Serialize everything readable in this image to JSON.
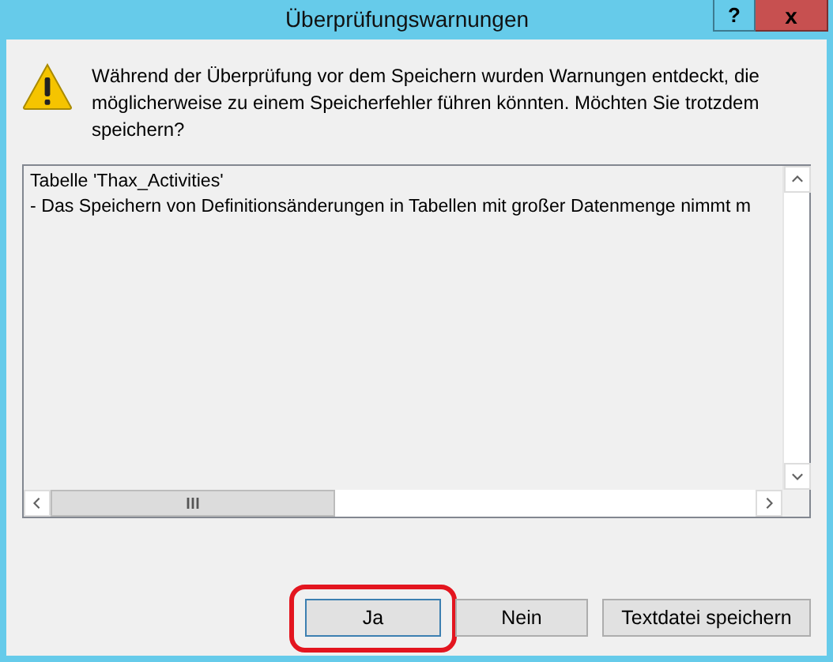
{
  "window": {
    "title": "Überprüfungswarnungen",
    "help_button": "?",
    "close_button": "x"
  },
  "message": "Während der Überprüfung vor dem Speichern wurden Warnungen entdeckt, die möglicherweise zu einem Speicherfehler führen könnten. Möchten Sie trotzdem speichern?",
  "details": {
    "lines": [
      "Tabelle 'Thax_Activities'",
      "- Das Speichern von Definitionsänderungen in Tabellen mit großer Datenmenge nimmt m"
    ]
  },
  "buttons": [
    {
      "label": "Ja",
      "focused": true,
      "highlighted": true
    },
    {
      "label": "Nein",
      "focused": false,
      "highlighted": false
    },
    {
      "label": "Textdatei speichern",
      "focused": false,
      "highlighted": false
    }
  ]
}
